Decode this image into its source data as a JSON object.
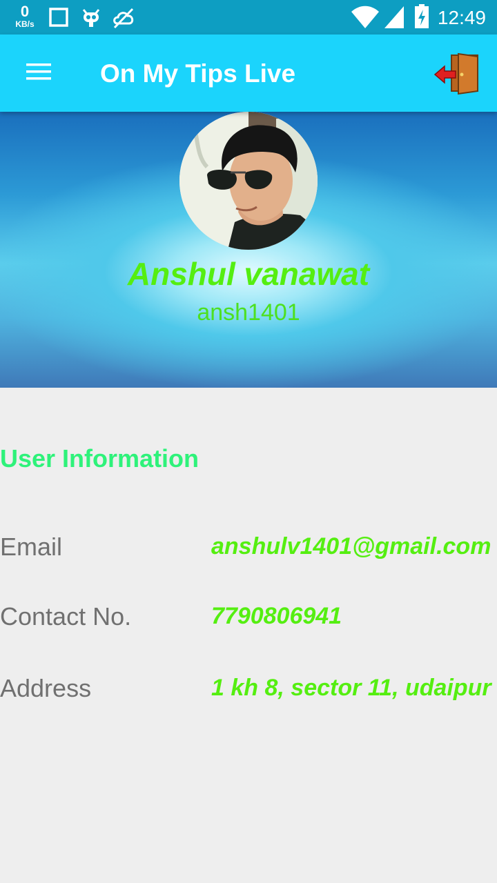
{
  "status_bar": {
    "net_speed_value": "0",
    "net_speed_unit": "KB/s",
    "time": "12:49",
    "icons": [
      "square-icon",
      "cyanogen-bot-icon",
      "no-signal-cloud-icon",
      "wifi-icon",
      "cell-signal-icon",
      "battery-charging-icon"
    ]
  },
  "app_bar": {
    "title": "On My Tips Live",
    "menu_icon": "hamburger-menu-icon",
    "logout_icon": "logout-door-icon"
  },
  "profile": {
    "name": "Anshul vanawat",
    "username": "ansh1401"
  },
  "user_info": {
    "title": "User Information",
    "rows": [
      {
        "label": "Email",
        "value": "anshulv1401@gmail.com"
      },
      {
        "label": "Contact No.",
        "value": "7790806941"
      },
      {
        "label": "Address",
        "value": "1 kh 8, sector 11, udaipur"
      }
    ]
  },
  "colors": {
    "status_bar": "#0d9ec2",
    "app_bar": "#1bd4fc",
    "name_green": "#55ee11",
    "section_title": "#2ef27a",
    "label_gray": "#707070",
    "background": "#eeeeee"
  }
}
